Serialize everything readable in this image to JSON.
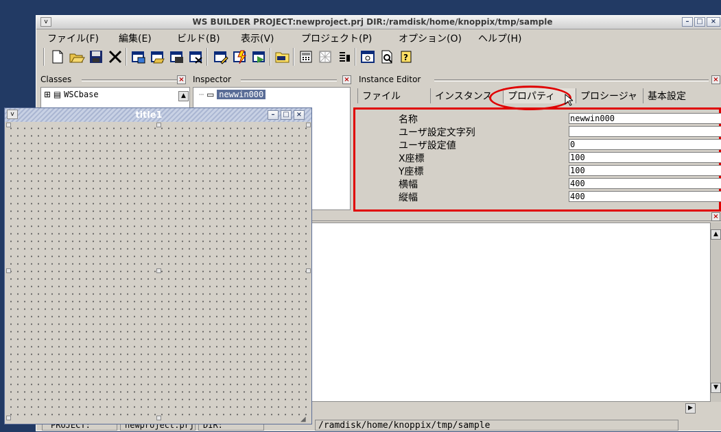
{
  "window": {
    "title": "WS BUILDER PROJECT:newproject.prj DIR:/ramdisk/home/knoppix/tmp/sample",
    "menu_btn": "v",
    "controls": [
      "–",
      "□",
      "×"
    ]
  },
  "menu": [
    "ファイル(F)",
    "編集(E)",
    "ビルド(B)",
    "表示(V)",
    "プロジェクト(P)",
    "オプション(O)",
    "ヘルプ(H)"
  ],
  "toolbar": {
    "icons": [
      "new-file-icon",
      "open-folder-icon",
      "save-icon",
      "delete-icon",
      "window-add-icon",
      "window-open-icon",
      "window-new-icon",
      "window-delete-icon",
      "edit-icon",
      "build-icon",
      "run-icon",
      "folder-icon",
      "calculator-icon",
      "image-icon",
      "align-icon",
      "preview-icon",
      "page-search-icon",
      "help-icon"
    ]
  },
  "classes": {
    "title": "Classes",
    "items": [
      {
        "label": "WSCbase"
      }
    ]
  },
  "inspector": {
    "title": "Inspector",
    "selected": "newwin000"
  },
  "instance_editor": {
    "title": "Instance Editor",
    "tabs": [
      "ファイル",
      "インスタンス",
      "プロパティ",
      "プロシージャ",
      "基本設定"
    ],
    "active_tab": "プロパティ",
    "properties": [
      {
        "label": "名称",
        "value": "newwin000"
      },
      {
        "label": "ユーザ設定文字列",
        "value": ""
      },
      {
        "label": "ユーザ設定値",
        "value": "0"
      },
      {
        "label": "X座標",
        "value": "100"
      },
      {
        "label": "Y座標",
        "value": "100"
      },
      {
        "label": "横幅",
        "value": "400"
      },
      {
        "label": "縦幅",
        "value": "400"
      }
    ]
  },
  "floating_window": {
    "title": "title1",
    "menu_btn": "v",
    "controls": [
      "–",
      "□",
      "×"
    ]
  },
  "statusbar": {
    "project_label": "PROJECT:",
    "project_value": "newproject.prj",
    "dir_label": "DIR:",
    "dir_value": "/ramdisk/home/knoppix/tmp/sample"
  },
  "annotations": {
    "highlight_color": "#e00000"
  }
}
